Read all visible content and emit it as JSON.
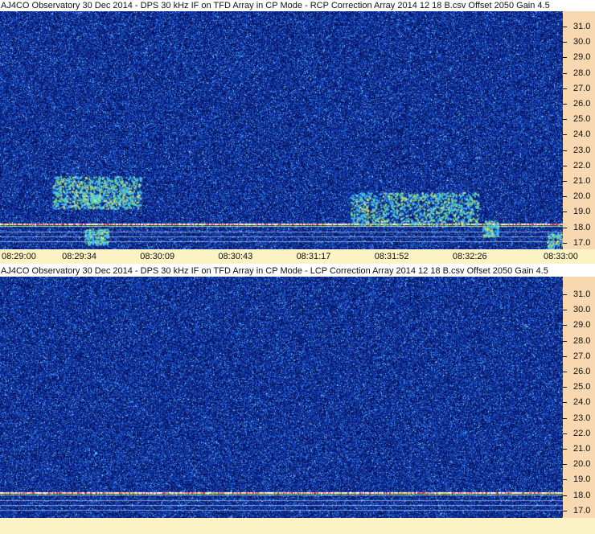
{
  "panels": [
    {
      "title": "AJ4CO Observatory 30 Dec 2014 - DPS 30 kHz IF on TFD Array in CP Mode - RCP     Correction Array 2014 12 18 B.csv  Offset 2050  Gain 4.5",
      "frequency_ticks": [
        "31.0",
        "30.0",
        "29.0",
        "28.0",
        "27.0",
        "26.0",
        "25.0",
        "24.0",
        "23.0",
        "22.0",
        "21.0",
        "20.0",
        "19.0",
        "18.0",
        "17.0"
      ],
      "time_ticks": [
        "08:29:00",
        "08:29:34",
        "08:30:09",
        "08:30:43",
        "08:31:17",
        "08:31:52",
        "08:32:26",
        "08:33:00"
      ]
    },
    {
      "title": "AJ4CO Observatory 30 Dec 2014 - DPS 30 kHz IF on TFD Array in CP Mode - LCP     Correction Array 2014 12 18 B.csv  Offset 2050  Gain 4.5",
      "frequency_ticks": [
        "31.0",
        "30.0",
        "29.0",
        "28.0",
        "27.0",
        "26.0",
        "25.0",
        "24.0",
        "23.0",
        "22.0",
        "21.0",
        "20.0",
        "19.0",
        "18.0",
        "17.0"
      ],
      "time_ticks": []
    }
  ],
  "colors": {
    "background": "#0a1d8e",
    "noise_bright": "#3fa0ff",
    "signal_green": "#7fe07a",
    "signal_yellow": "#f2e86b",
    "interference_red": "#e0407a",
    "axis_bg": "#f7d8b0",
    "time_axis_bg": "#fbf3c3"
  }
}
